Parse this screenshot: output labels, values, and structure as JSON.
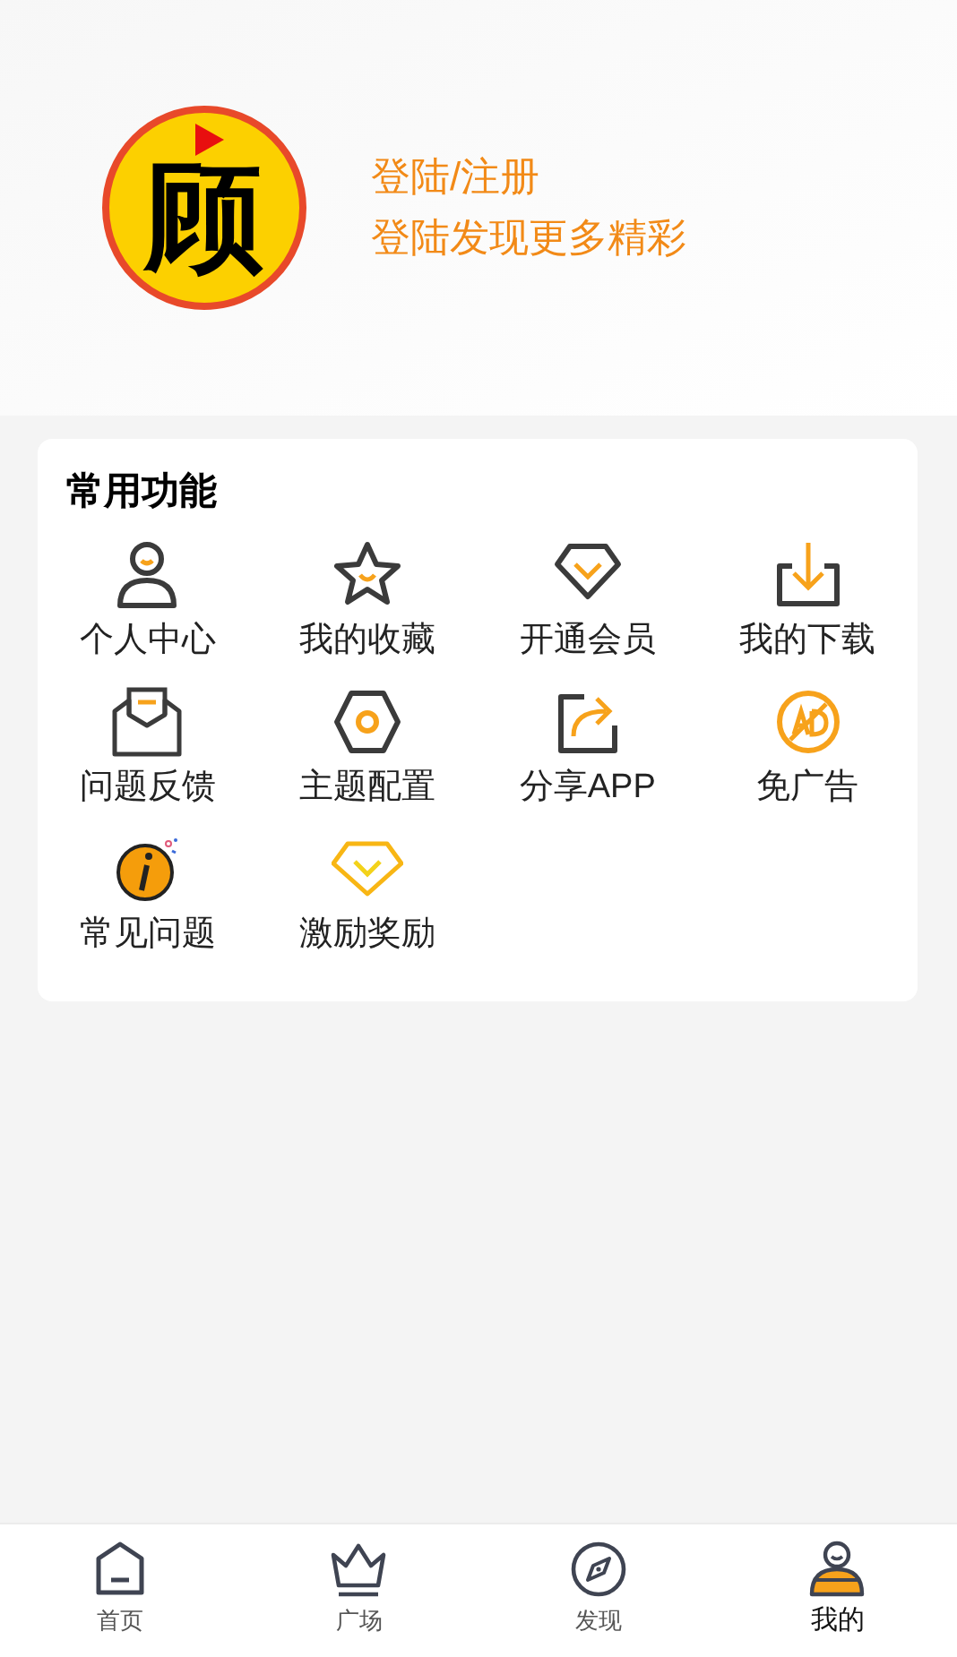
{
  "profile": {
    "logo_text": "顾",
    "title": "登陆/注册",
    "subtitle": "登陆发现更多精彩"
  },
  "functions": {
    "title": "常用功能",
    "items": [
      {
        "label": "个人中心"
      },
      {
        "label": "我的收藏"
      },
      {
        "label": "开通会员"
      },
      {
        "label": "我的下载"
      },
      {
        "label": "问题反馈"
      },
      {
        "label": "主题配置"
      },
      {
        "label": "分享APP"
      },
      {
        "label": "免广告"
      },
      {
        "label": "常见问题"
      },
      {
        "label": "激励奖励"
      }
    ]
  },
  "tabs": [
    {
      "label": "首页",
      "selected": false
    },
    {
      "label": "广场",
      "selected": false
    },
    {
      "label": "发现",
      "selected": false
    },
    {
      "label": "我的",
      "selected": true
    }
  ]
}
